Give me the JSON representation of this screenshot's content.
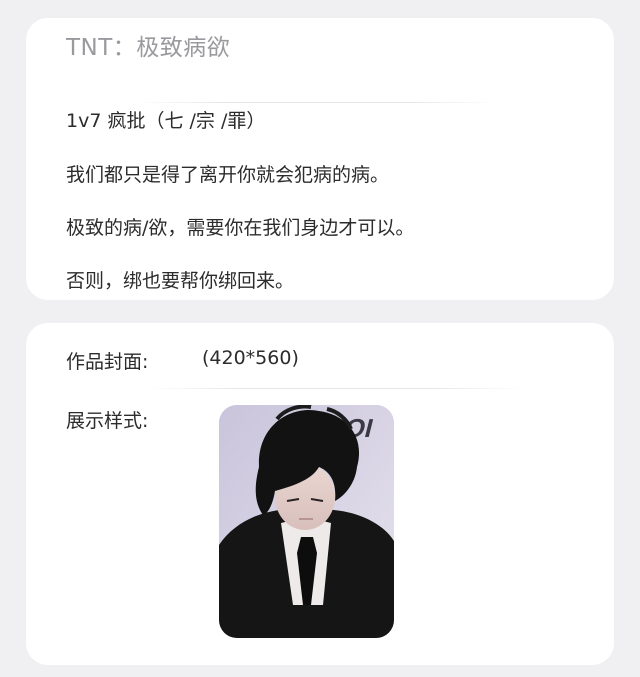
{
  "description_card": {
    "title": "TNT：极致病欲",
    "lines": [
      "1v7 疯批（七 /宗 /罪）",
      "我们都只是得了离开你就会犯病的病。",
      "极致的病/欲，需要你在我们身边才可以。",
      "否则，绑也要帮你绑回来。"
    ]
  },
  "cover_card": {
    "cover_label": "作品封面:",
    "cover_size": "(420*560)",
    "style_label": "展示样式:",
    "image_watermark": "OI"
  },
  "colors": {
    "page_background": "#f0f0f2",
    "card_background": "#ffffff",
    "title_gray": "#9a9a9e",
    "text": "#2c2c2c"
  }
}
